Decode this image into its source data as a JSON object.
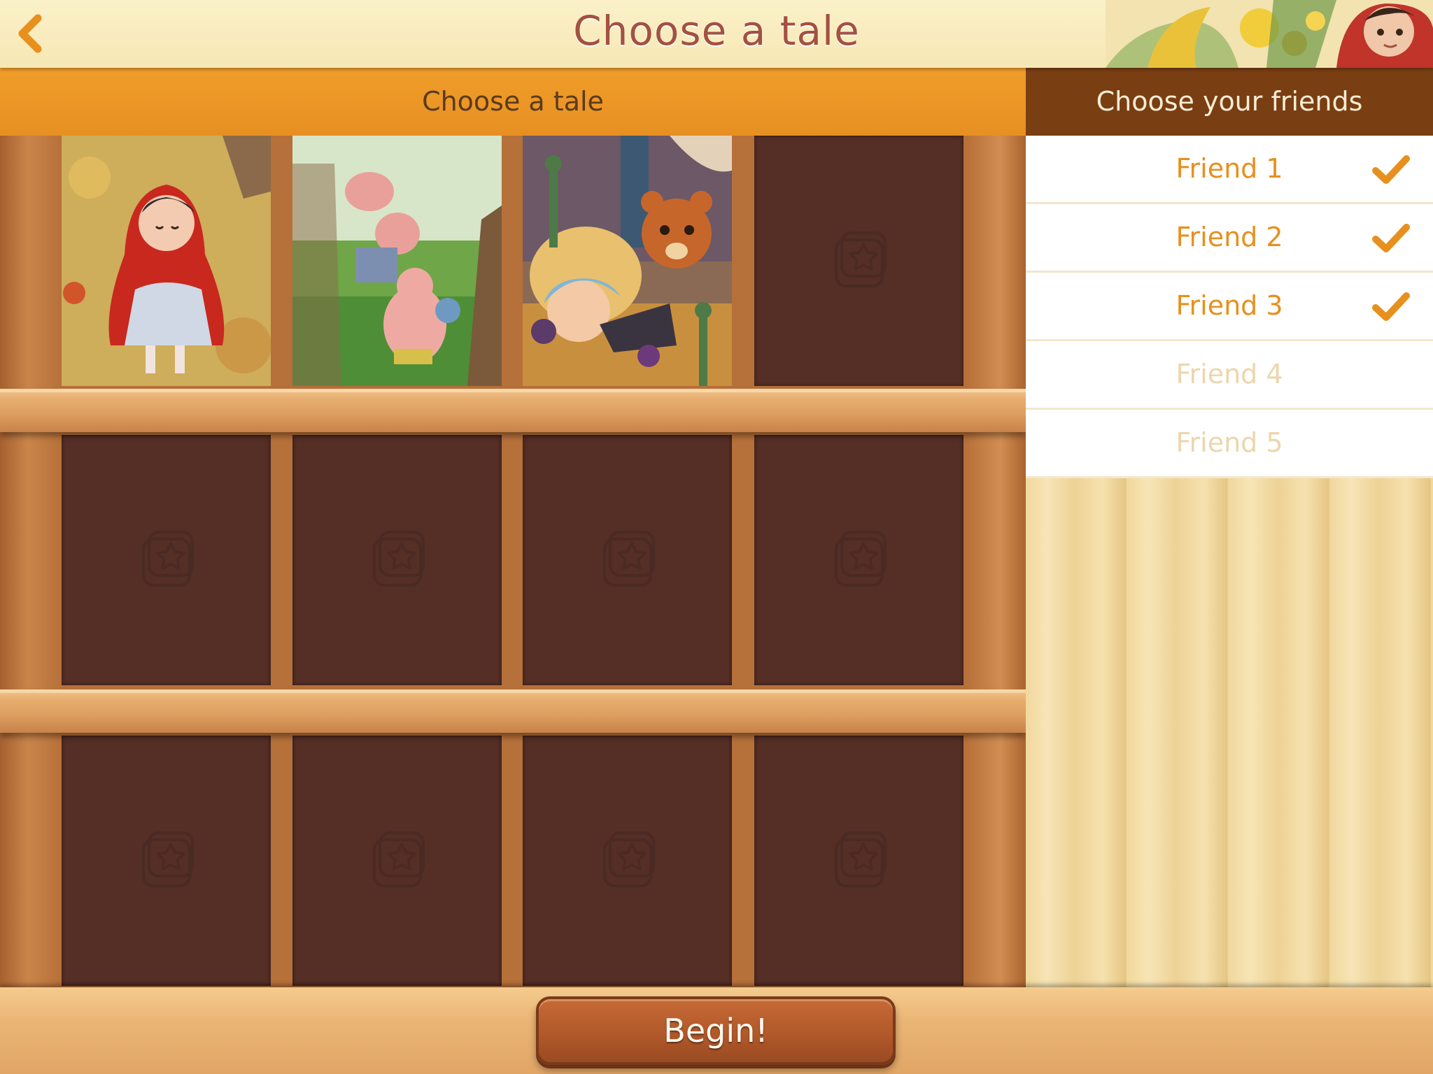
{
  "header": {
    "title": "Choose a tale",
    "back_icon": "chevron-left-icon"
  },
  "tales_section": {
    "title": "Choose a tale",
    "slots": [
      {
        "state": "filled",
        "illustration": "girl-in-red-hood"
      },
      {
        "state": "filled",
        "illustration": "three-pigs"
      },
      {
        "state": "filled",
        "illustration": "girl-sleeping-with-bear"
      },
      {
        "state": "empty",
        "icon": "storybook-star-icon"
      },
      {
        "state": "empty",
        "icon": "storybook-star-icon"
      },
      {
        "state": "empty",
        "icon": "storybook-star-icon"
      },
      {
        "state": "empty",
        "icon": "storybook-star-icon"
      },
      {
        "state": "empty",
        "icon": "storybook-star-icon"
      },
      {
        "state": "empty",
        "icon": "storybook-star-icon"
      },
      {
        "state": "empty",
        "icon": "storybook-star-icon"
      },
      {
        "state": "empty",
        "icon": "storybook-star-icon"
      },
      {
        "state": "empty",
        "icon": "storybook-star-icon"
      }
    ]
  },
  "friends_section": {
    "title": "Choose your friends",
    "friends": [
      {
        "label": "Friend 1",
        "selected": true
      },
      {
        "label": "Friend 2",
        "selected": true
      },
      {
        "label": "Friend 3",
        "selected": true
      },
      {
        "label": "Friend 4",
        "selected": false
      },
      {
        "label": "Friend 5",
        "selected": false
      }
    ]
  },
  "footer": {
    "begin_label": "Begin!"
  },
  "colors": {
    "accent_orange": "#e7901e",
    "header_orange": "#e79022",
    "friends_header_brown": "#7a3e13",
    "title_color": "#a4513f",
    "slot_brown": "#552e26"
  }
}
